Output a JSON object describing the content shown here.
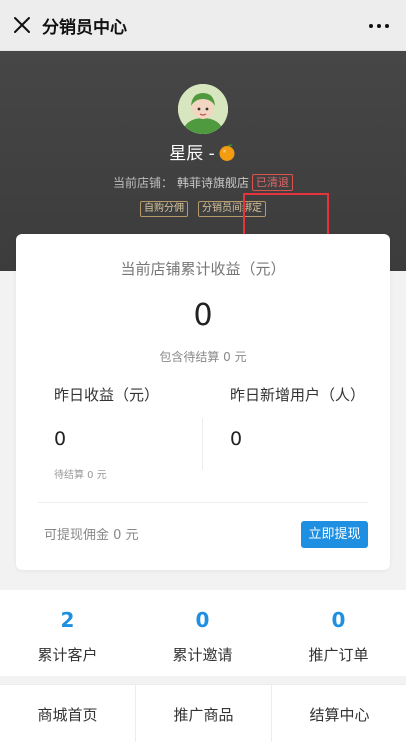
{
  "topbar": {
    "title": "分销员中心",
    "more_label": "···"
  },
  "profile": {
    "nickname": "星辰 -",
    "store_prefix": "当前店铺：",
    "store_name": "韩菲诗旗舰店",
    "status": "已清退",
    "tags": [
      "自购分佣",
      "分销员间绑定"
    ]
  },
  "earnings": {
    "title": "当前店铺累计收益（元）",
    "total": "0",
    "pending": "包含待结算 0 元",
    "yesterday_label": "昨日收益（元）",
    "yesterday_value": "0",
    "yesterday_pending": "待结算 0 元",
    "new_users_label": "昨日新增用户（人）",
    "new_users_value": "0",
    "withdrawable": "可提现佣金 0 元",
    "withdraw_button": "立即提现"
  },
  "stats": [
    {
      "value": "2",
      "label": "累计客户"
    },
    {
      "value": "0",
      "label": "累计邀请"
    },
    {
      "value": "0",
      "label": "推广订单"
    }
  ],
  "menu": [
    {
      "label": "商城首页"
    },
    {
      "label": "推广商品"
    },
    {
      "label": "结算中心"
    }
  ],
  "colors": {
    "accent": "#1e8fe1",
    "status_red": "#e06666",
    "header_dark": "#404040"
  }
}
